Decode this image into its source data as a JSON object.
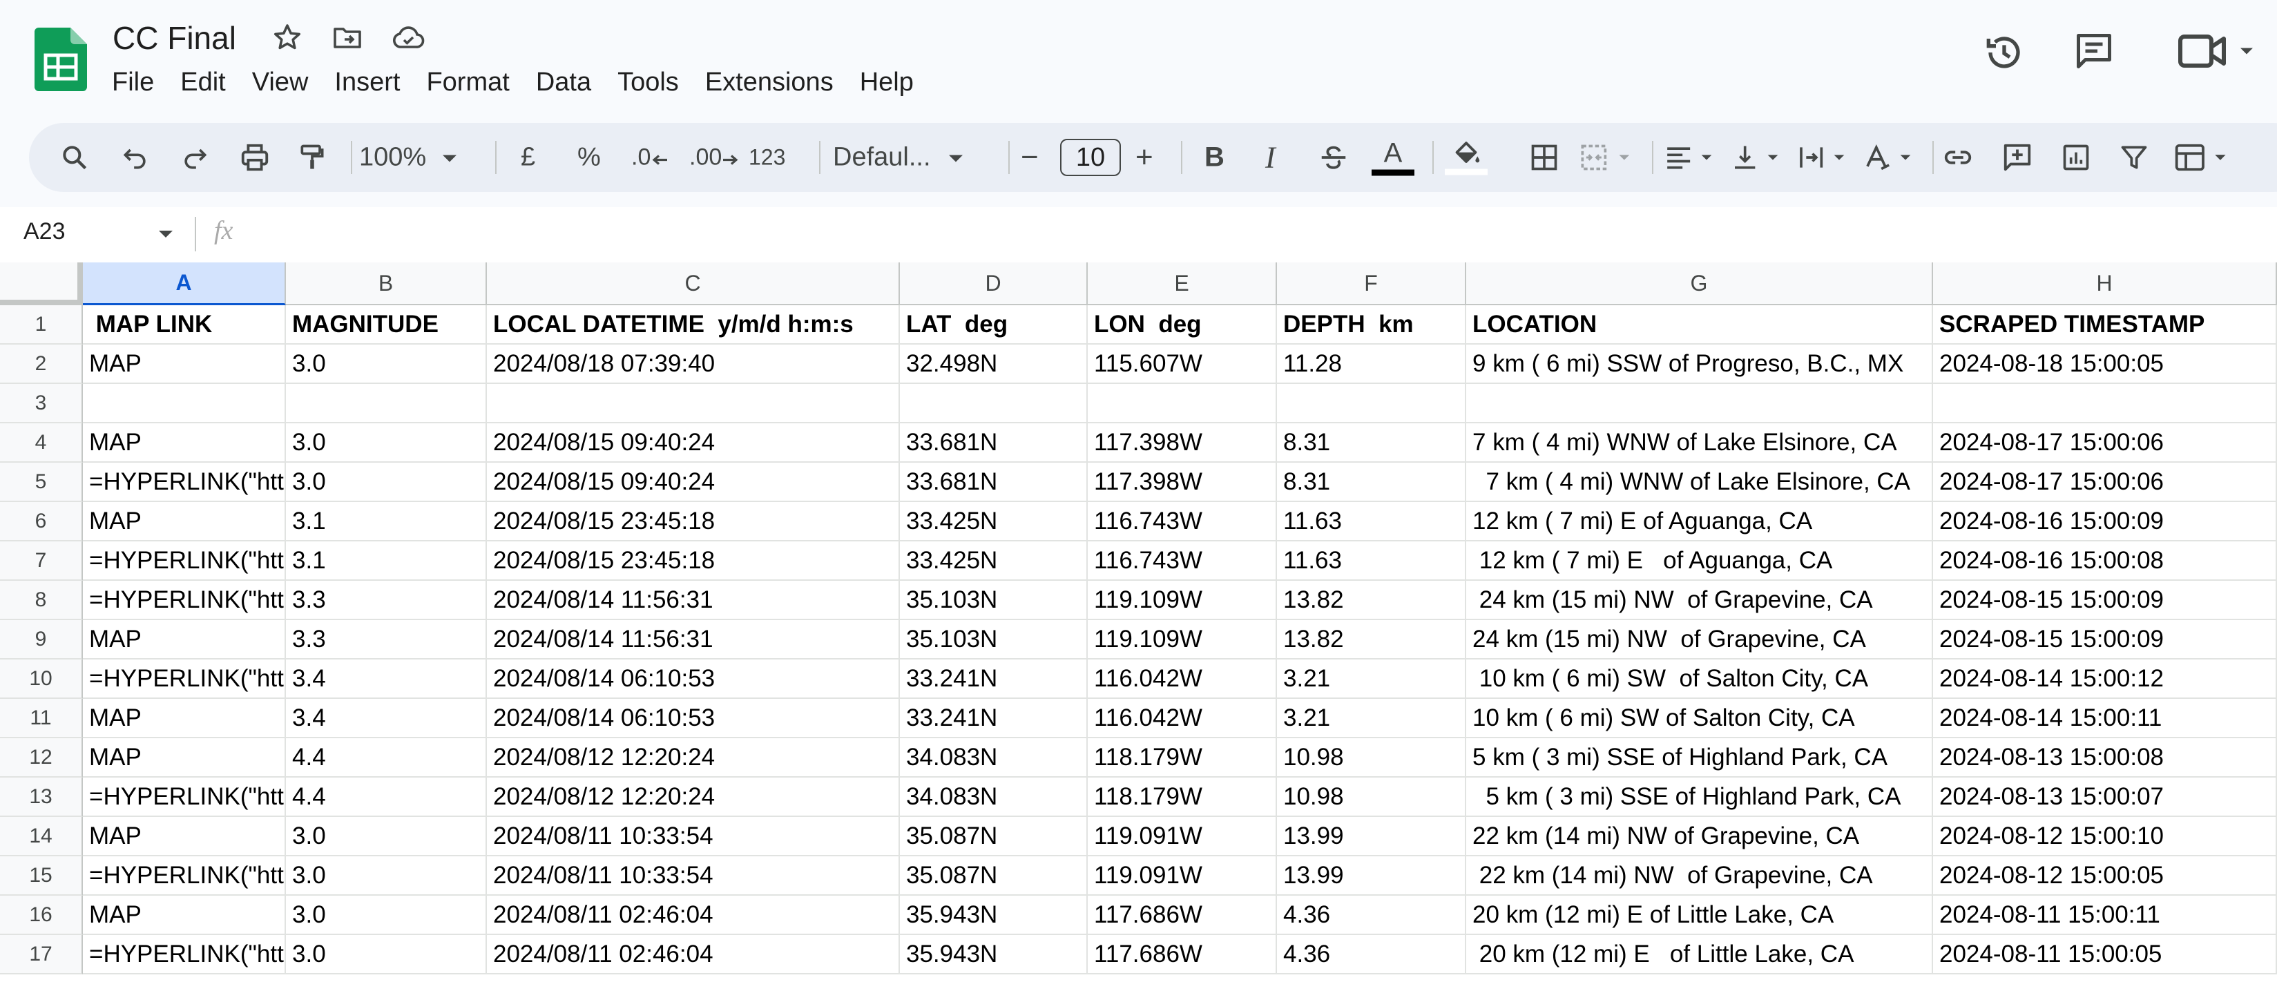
{
  "title": "CC Final",
  "menu": [
    "File",
    "Edit",
    "View",
    "Insert",
    "Format",
    "Data",
    "Tools",
    "Extensions",
    "Help"
  ],
  "toolbar": {
    "zoom": "100%",
    "currency": "£",
    "percent": "%",
    "decrease_decimal": ".0",
    "increase_decimal": ".00",
    "number_format": "123",
    "font": "Defaul...",
    "font_size": "10",
    "minus": "−",
    "plus": "+",
    "bold": "B",
    "italic": "I",
    "text_color": "A"
  },
  "formula_bar": {
    "name_box": "A23",
    "fx": "fx",
    "value": ""
  },
  "grid": {
    "selected_column": "A",
    "columns": [
      "A",
      "B",
      "C",
      "D",
      "E",
      "F",
      "G",
      "H"
    ],
    "row_numbers": [
      "1",
      "2",
      "3",
      "4",
      "5",
      "6",
      "7",
      "8",
      "9",
      "10",
      "11",
      "12",
      "13",
      "14",
      "15",
      "16",
      "17"
    ],
    "rows": [
      [
        " MAP LINK",
        "MAGNITUDE",
        "LOCAL DATETIME  y/m/d h:m:s",
        "LAT  deg",
        "LON  deg",
        "DEPTH  km",
        "LOCATION",
        "SCRAPED TIMESTAMP"
      ],
      [
        "MAP",
        "3.0",
        "2024/08/18 07:39:40",
        "32.498N",
        "115.607W",
        "11.28",
        "9 km ( 6 mi) SSW of Progreso, B.C., MX",
        "2024-08-18 15:00:05"
      ],
      [
        "",
        "",
        "",
        "",
        "",
        "",
        "",
        ""
      ],
      [
        "MAP",
        "3.0",
        "2024/08/15 09:40:24",
        "33.681N",
        "117.398W",
        "8.31",
        "7 km ( 4 mi) WNW of Lake Elsinore, CA",
        "2024-08-17 15:00:06"
      ],
      [
        "=HYPERLINK(\"htt",
        "3.0",
        "2024/08/15 09:40:24",
        "33.681N",
        "117.398W",
        "8.31",
        "  7 km ( 4 mi) WNW of Lake Elsinore, CA",
        "2024-08-17 15:00:06"
      ],
      [
        "MAP",
        "3.1",
        "2024/08/15 23:45:18",
        "33.425N",
        "116.743W",
        "11.63",
        "12 km ( 7 mi) E of Aguanga, CA",
        "2024-08-16 15:00:09"
      ],
      [
        "=HYPERLINK(\"htt",
        "3.1",
        "2024/08/15 23:45:18",
        "33.425N",
        "116.743W",
        "11.63",
        " 12 km ( 7 mi) E   of Aguanga, CA",
        "2024-08-16 15:00:08"
      ],
      [
        "=HYPERLINK(\"htt",
        "3.3",
        "2024/08/14 11:56:31",
        "35.103N",
        "119.109W",
        "13.82",
        " 24 km (15 mi) NW  of Grapevine, CA",
        "2024-08-15 15:00:09"
      ],
      [
        "MAP",
        "3.3",
        "2024/08/14 11:56:31",
        "35.103N",
        "119.109W",
        "13.82",
        "24 km (15 mi) NW  of Grapevine, CA",
        "2024-08-15 15:00:09"
      ],
      [
        "=HYPERLINK(\"htt",
        "3.4",
        "2024/08/14 06:10:53",
        "33.241N",
        "116.042W",
        "3.21",
        " 10 km ( 6 mi) SW  of Salton City, CA",
        "2024-08-14 15:00:12"
      ],
      [
        "MAP",
        "3.4",
        "2024/08/14 06:10:53",
        "33.241N",
        "116.042W",
        "3.21",
        "10 km ( 6 mi) SW of Salton City, CA",
        "2024-08-14 15:00:11"
      ],
      [
        "MAP",
        "4.4",
        "2024/08/12 12:20:24",
        "34.083N",
        "118.179W",
        "10.98",
        "5 km ( 3 mi) SSE of Highland Park, CA",
        "2024-08-13 15:00:08"
      ],
      [
        "=HYPERLINK(\"htt",
        "4.4",
        "2024/08/12 12:20:24",
        "34.083N",
        "118.179W",
        "10.98",
        "  5 km ( 3 mi) SSE of Highland Park, CA",
        "2024-08-13 15:00:07"
      ],
      [
        "MAP",
        "3.0",
        "2024/08/11 10:33:54",
        "35.087N",
        "119.091W",
        "13.99",
        "22 km (14 mi) NW of Grapevine, CA",
        "2024-08-12 15:00:10"
      ],
      [
        "=HYPERLINK(\"htt",
        "3.0",
        "2024/08/11 10:33:54",
        "35.087N",
        "119.091W",
        "13.99",
        " 22 km (14 mi) NW  of Grapevine, CA",
        "2024-08-12 15:00:05"
      ],
      [
        "MAP",
        "3.0",
        "2024/08/11 02:46:04",
        "35.943N",
        "117.686W",
        "4.36",
        "20 km (12 mi) E of Little Lake, CA",
        "2024-08-11 15:00:11"
      ],
      [
        "=HYPERLINK(\"htt",
        "3.0",
        "2024/08/11 02:46:04",
        "35.943N",
        "117.686W",
        "4.36",
        " 20 km (12 mi) E   of Little Lake, CA",
        "2024-08-11 15:00:05"
      ]
    ]
  },
  "colors": {
    "sheets_green": "#0f9d58",
    "selection": "#d3e3fd",
    "accent": "#0b57d0"
  },
  "icons": [
    "sheets-logo-icon",
    "star-icon",
    "move-folder-icon",
    "cloud-status-icon",
    "history-icon",
    "comments-icon",
    "meet-icon",
    "search-icon",
    "undo-icon",
    "redo-icon",
    "print-icon",
    "paint-format-icon",
    "borders-icon",
    "merge-icon",
    "link-icon",
    "insert-comment-icon",
    "insert-chart-icon",
    "filter-icon",
    "table-icon"
  ]
}
